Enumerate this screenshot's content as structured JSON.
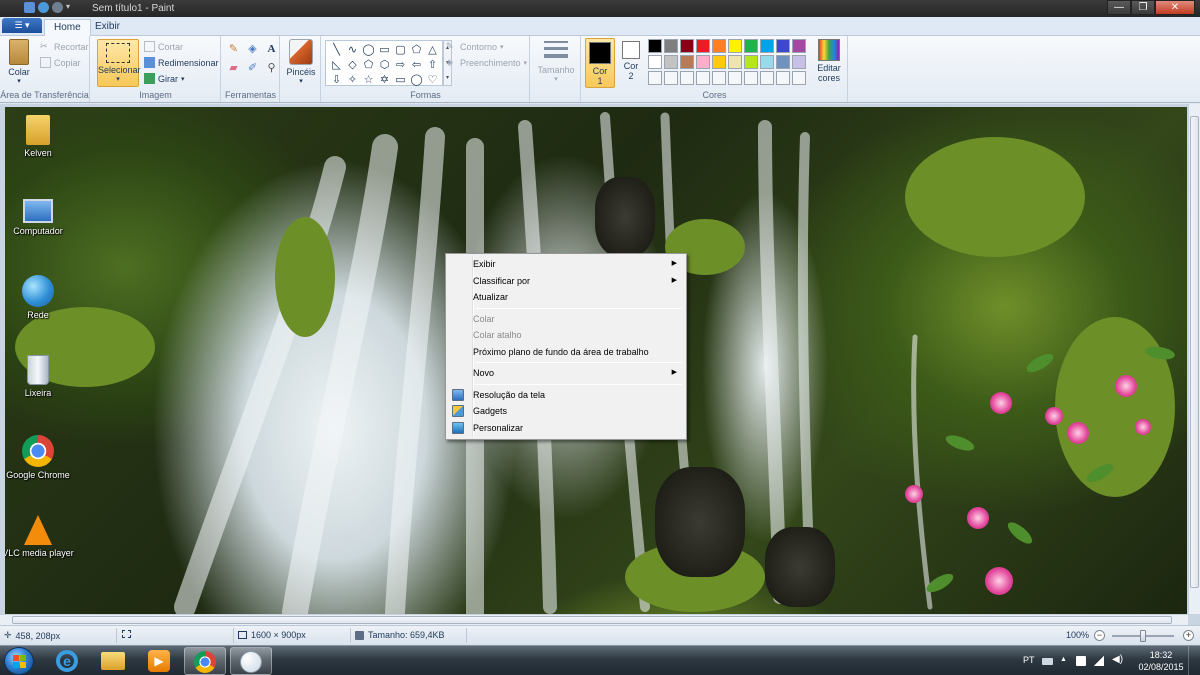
{
  "window": {
    "title": "Sem título1 - Paint",
    "controls": {
      "minimize": "—",
      "maximize": "❐",
      "close": "✕"
    }
  },
  "ribbon_tabs": [
    {
      "label": "Home",
      "active": true
    },
    {
      "label": "Exibir",
      "active": false
    }
  ],
  "ribbon": {
    "clipboard": {
      "label": "Área de Transferência",
      "paste": "Colar",
      "cut": "Recortar",
      "copy": "Copiar"
    },
    "image": {
      "label": "Imagem",
      "select": "Selecionar",
      "crop": "Cortar",
      "resize": "Redimensionar",
      "rotate": "Girar"
    },
    "tools": {
      "label": "Ferramentas"
    },
    "brushes": {
      "label": "Pincéis"
    },
    "shapes": {
      "label": "Formas",
      "outline": "Contorno",
      "fill": "Preenchimento"
    },
    "size": {
      "label": "Tamanho"
    },
    "colors": {
      "label": "Cores",
      "color1": "Cor",
      "color1_num": "1",
      "color2": "Cor",
      "color2_num": "2",
      "edit": "Editar",
      "edit2": "cores",
      "color1_value": "#000000",
      "color2_value": "#ffffff",
      "palette": [
        "#000000",
        "#7f7f7f",
        "#880015",
        "#ed1c24",
        "#ff7f27",
        "#fff200",
        "#22b14c",
        "#00a2e8",
        "#3f48cc",
        "#a349a4",
        "#ffffff",
        "#c3c3c3",
        "#b97a57",
        "#ffaec9",
        "#ffc90e",
        "#efe4b0",
        "#b5e61d",
        "#99d9ea",
        "#7092be",
        "#c8bfe7",
        "#ffffff",
        "#ffffff",
        "#ffffff",
        "#ffffff",
        "#ffffff",
        "#ffffff",
        "#ffffff",
        "#ffffff",
        "#ffffff",
        "#ffffff"
      ]
    }
  },
  "desktop_icons": [
    {
      "label": "Kelven",
      "icon": "user-folder-icon"
    },
    {
      "label": "Computador",
      "icon": "computer-icon"
    },
    {
      "label": "Rede",
      "icon": "network-icon"
    },
    {
      "label": "Lixeira",
      "icon": "recycle-bin-icon"
    },
    {
      "label": "Google Chrome",
      "icon": "chrome-icon"
    },
    {
      "label": "VLC media player",
      "icon": "vlc-icon"
    }
  ],
  "context_menu": {
    "items": [
      {
        "label": "Exibir",
        "submenu": true
      },
      {
        "label": "Classificar por",
        "submenu": true
      },
      {
        "label": "Atualizar"
      },
      {
        "label": "Colar",
        "disabled": true
      },
      {
        "label": "Colar atalho",
        "disabled": true
      },
      {
        "label": "Próximo plano de fundo da área de trabalho"
      },
      {
        "label": "Novo",
        "submenu": true
      },
      {
        "label": "Resolução da tela",
        "icon": "screen-resolution-icon"
      },
      {
        "label": "Gadgets",
        "icon": "gadgets-icon"
      },
      {
        "label": "Personalizar",
        "icon": "personalize-icon"
      }
    ]
  },
  "statusbar": {
    "cursor": "458, 208px",
    "dimensions": "1600 × 900px",
    "size": "Tamanho: 659,4KB",
    "zoom": "100%",
    "zoom_out": "−",
    "zoom_in": "+"
  },
  "taskbar": {
    "apps": [
      "internet-explorer-icon",
      "explorer-icon",
      "media-player-icon",
      "chrome-icon",
      "paint-icon"
    ],
    "language": "PT",
    "time": "18:32",
    "date": "02/08/2015"
  }
}
